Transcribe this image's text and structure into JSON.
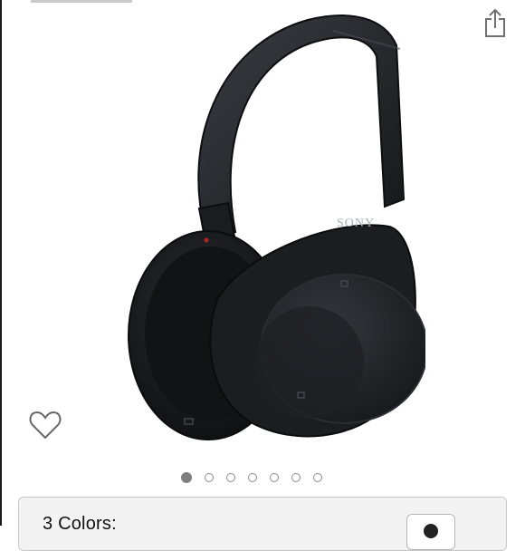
{
  "actions": {
    "share_icon": "share-icon",
    "wishlist_icon": "heart-icon"
  },
  "product": {
    "brand_logo": "SONY",
    "image_icon": "headphones-image"
  },
  "carousel": {
    "count": 7,
    "active_index": 0
  },
  "colors": {
    "label": "3 Colors:"
  },
  "palette": {
    "headphone_body": "#1d1f22",
    "dot_active": "#7f7f7f",
    "dot_border": "#8c8c8c"
  }
}
